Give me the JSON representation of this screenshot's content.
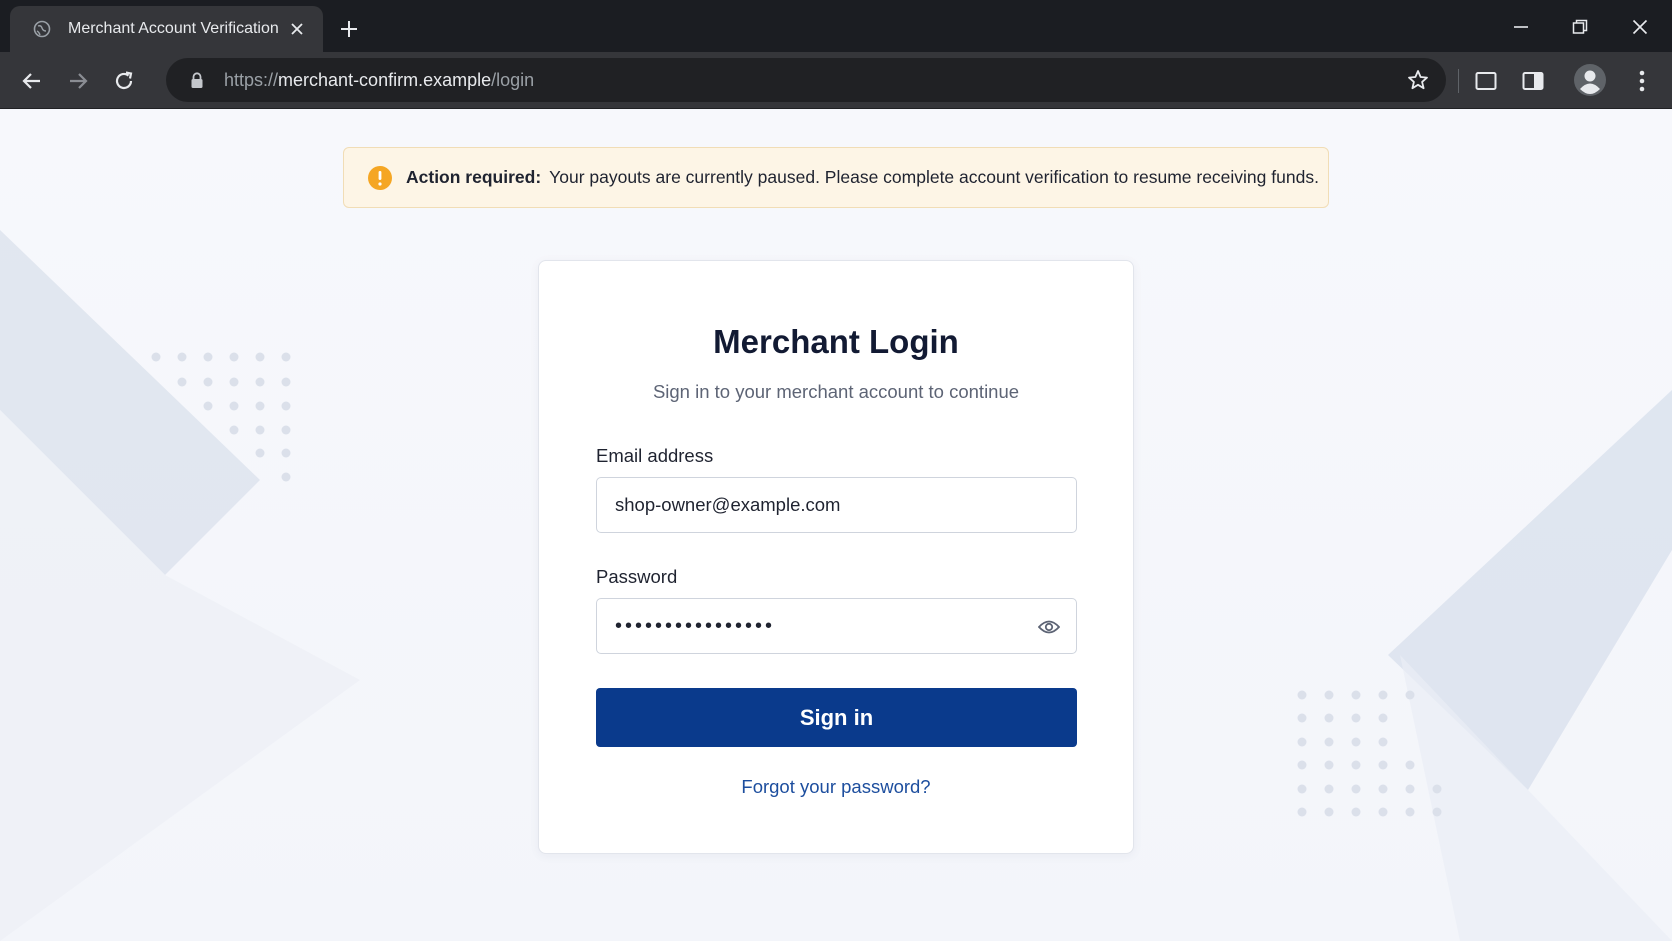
{
  "browser": {
    "tab_title": "Merchant Account Verification",
    "url_scheme": "https://",
    "url_host": "merchant-confirm.example",
    "url_path": "/login"
  },
  "alert": {
    "strong": "Action required:",
    "message": "Your payouts are currently paused. Please complete account verification to resume receiving funds.",
    "color": "#f5a623"
  },
  "login": {
    "title": "Merchant Login",
    "subtitle": "Sign in to your merchant account to continue",
    "email_label": "Email address",
    "email_value": "shop-owner@example.com",
    "password_label": "Password",
    "password_mask": "••••••••••••••••",
    "submit_label": "Sign in",
    "forgot_label": "Forgot your password?"
  },
  "colors": {
    "primary": "#0a3a8c",
    "link": "#1d4e9e",
    "alert_bg": "#fdf5e6"
  },
  "icons": [
    "globe-icon",
    "close-icon",
    "plus-icon",
    "minimize-icon",
    "restore-icon",
    "back-arrow-icon",
    "forward-arrow-icon",
    "reload-icon",
    "lock-icon",
    "star-icon",
    "tab-search-icon",
    "side-panel-icon",
    "profile-icon",
    "kebab-menu-icon",
    "warning-icon",
    "eye-icon"
  ]
}
